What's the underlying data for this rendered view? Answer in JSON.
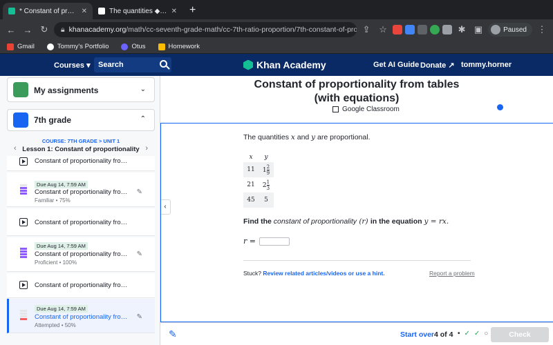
{
  "browser": {
    "tabs": [
      {
        "title": "* Constant of proportionality fr",
        "close": "✕",
        "active": true,
        "color": "#14bf96"
      },
      {
        "title": "The quantities ◆ xx and ◆ yy",
        "close": "✕",
        "active": false,
        "color": "#ffffff"
      }
    ],
    "new_tab": "+",
    "url_domain": "khanacademy.org",
    "url_path": "/math/cc-seventh-grade-math/cc-7th-ratio-proportion/7th-constant-of-proportionality/e/constant-of-proportionality...",
    "profile_label": "Paused",
    "bookmarks": [
      "Gmail",
      "Tommy's Portfolio",
      "Otus",
      "Homework"
    ]
  },
  "header": {
    "courses": "Courses ▾",
    "search": "Search",
    "logo": "Khan Academy",
    "get_ai": "Get AI Guide",
    "donate": "Donate ↗",
    "user": "tommy.horner"
  },
  "sidebar": {
    "assignments": "My assignments",
    "grade": "7th grade",
    "crumb": "COURSE: 7TH GRADE > UNIT 1",
    "lesson": "Lesson 1: Constant of proportionality",
    "items": [
      {
        "title": "Constant of proportionality from eq..."
      },
      {
        "due": "Due Aug 14, 7:59 AM",
        "title": "Constant of proportionality from ...",
        "sub": "Familiar • 75%"
      },
      {
        "title": "Constant of proportionality from ta..."
      },
      {
        "due": "Due Aug 14, 7:59 AM",
        "title": "Constant of proportionality from ...",
        "sub": "Proficient • 100%"
      },
      {
        "title": "Constant of proportionality from ta..."
      },
      {
        "due": "Due Aug 14, 7:59 AM",
        "title": "Constant of proportionality from ...",
        "sub": "Attempted • 50%"
      }
    ]
  },
  "main": {
    "title": "Constant of proportionality from tables (with equations)",
    "classroom": "Google Classroom",
    "stmt_pre": "The quantities ",
    "x": "x",
    "and": " and ",
    "y": "y",
    "stmt_post": " are proportional.",
    "table": {
      "headers": [
        "x",
        "y"
      ],
      "rows": [
        {
          "x": "11",
          "whole": "1",
          "num": "2",
          "den": "9"
        },
        {
          "x": "21",
          "whole": "2",
          "num": "1",
          "den": "3"
        },
        {
          "x": "45",
          "whole": "5",
          "num": "",
          "den": ""
        }
      ]
    },
    "find_pre": "Find the ",
    "find_em": "constant of proportionality",
    "find_r": " (r) ",
    "find_mid": "in the equation ",
    "find_eq": "y = rx.",
    "answer_label": "r =",
    "stuck": "Stuck?",
    "stuck_link": "Review related articles/videos or use a hint.",
    "report": "Report a problem"
  },
  "footer": {
    "start_over": "Start over",
    "count": "4 of 4",
    "check": "Check"
  }
}
